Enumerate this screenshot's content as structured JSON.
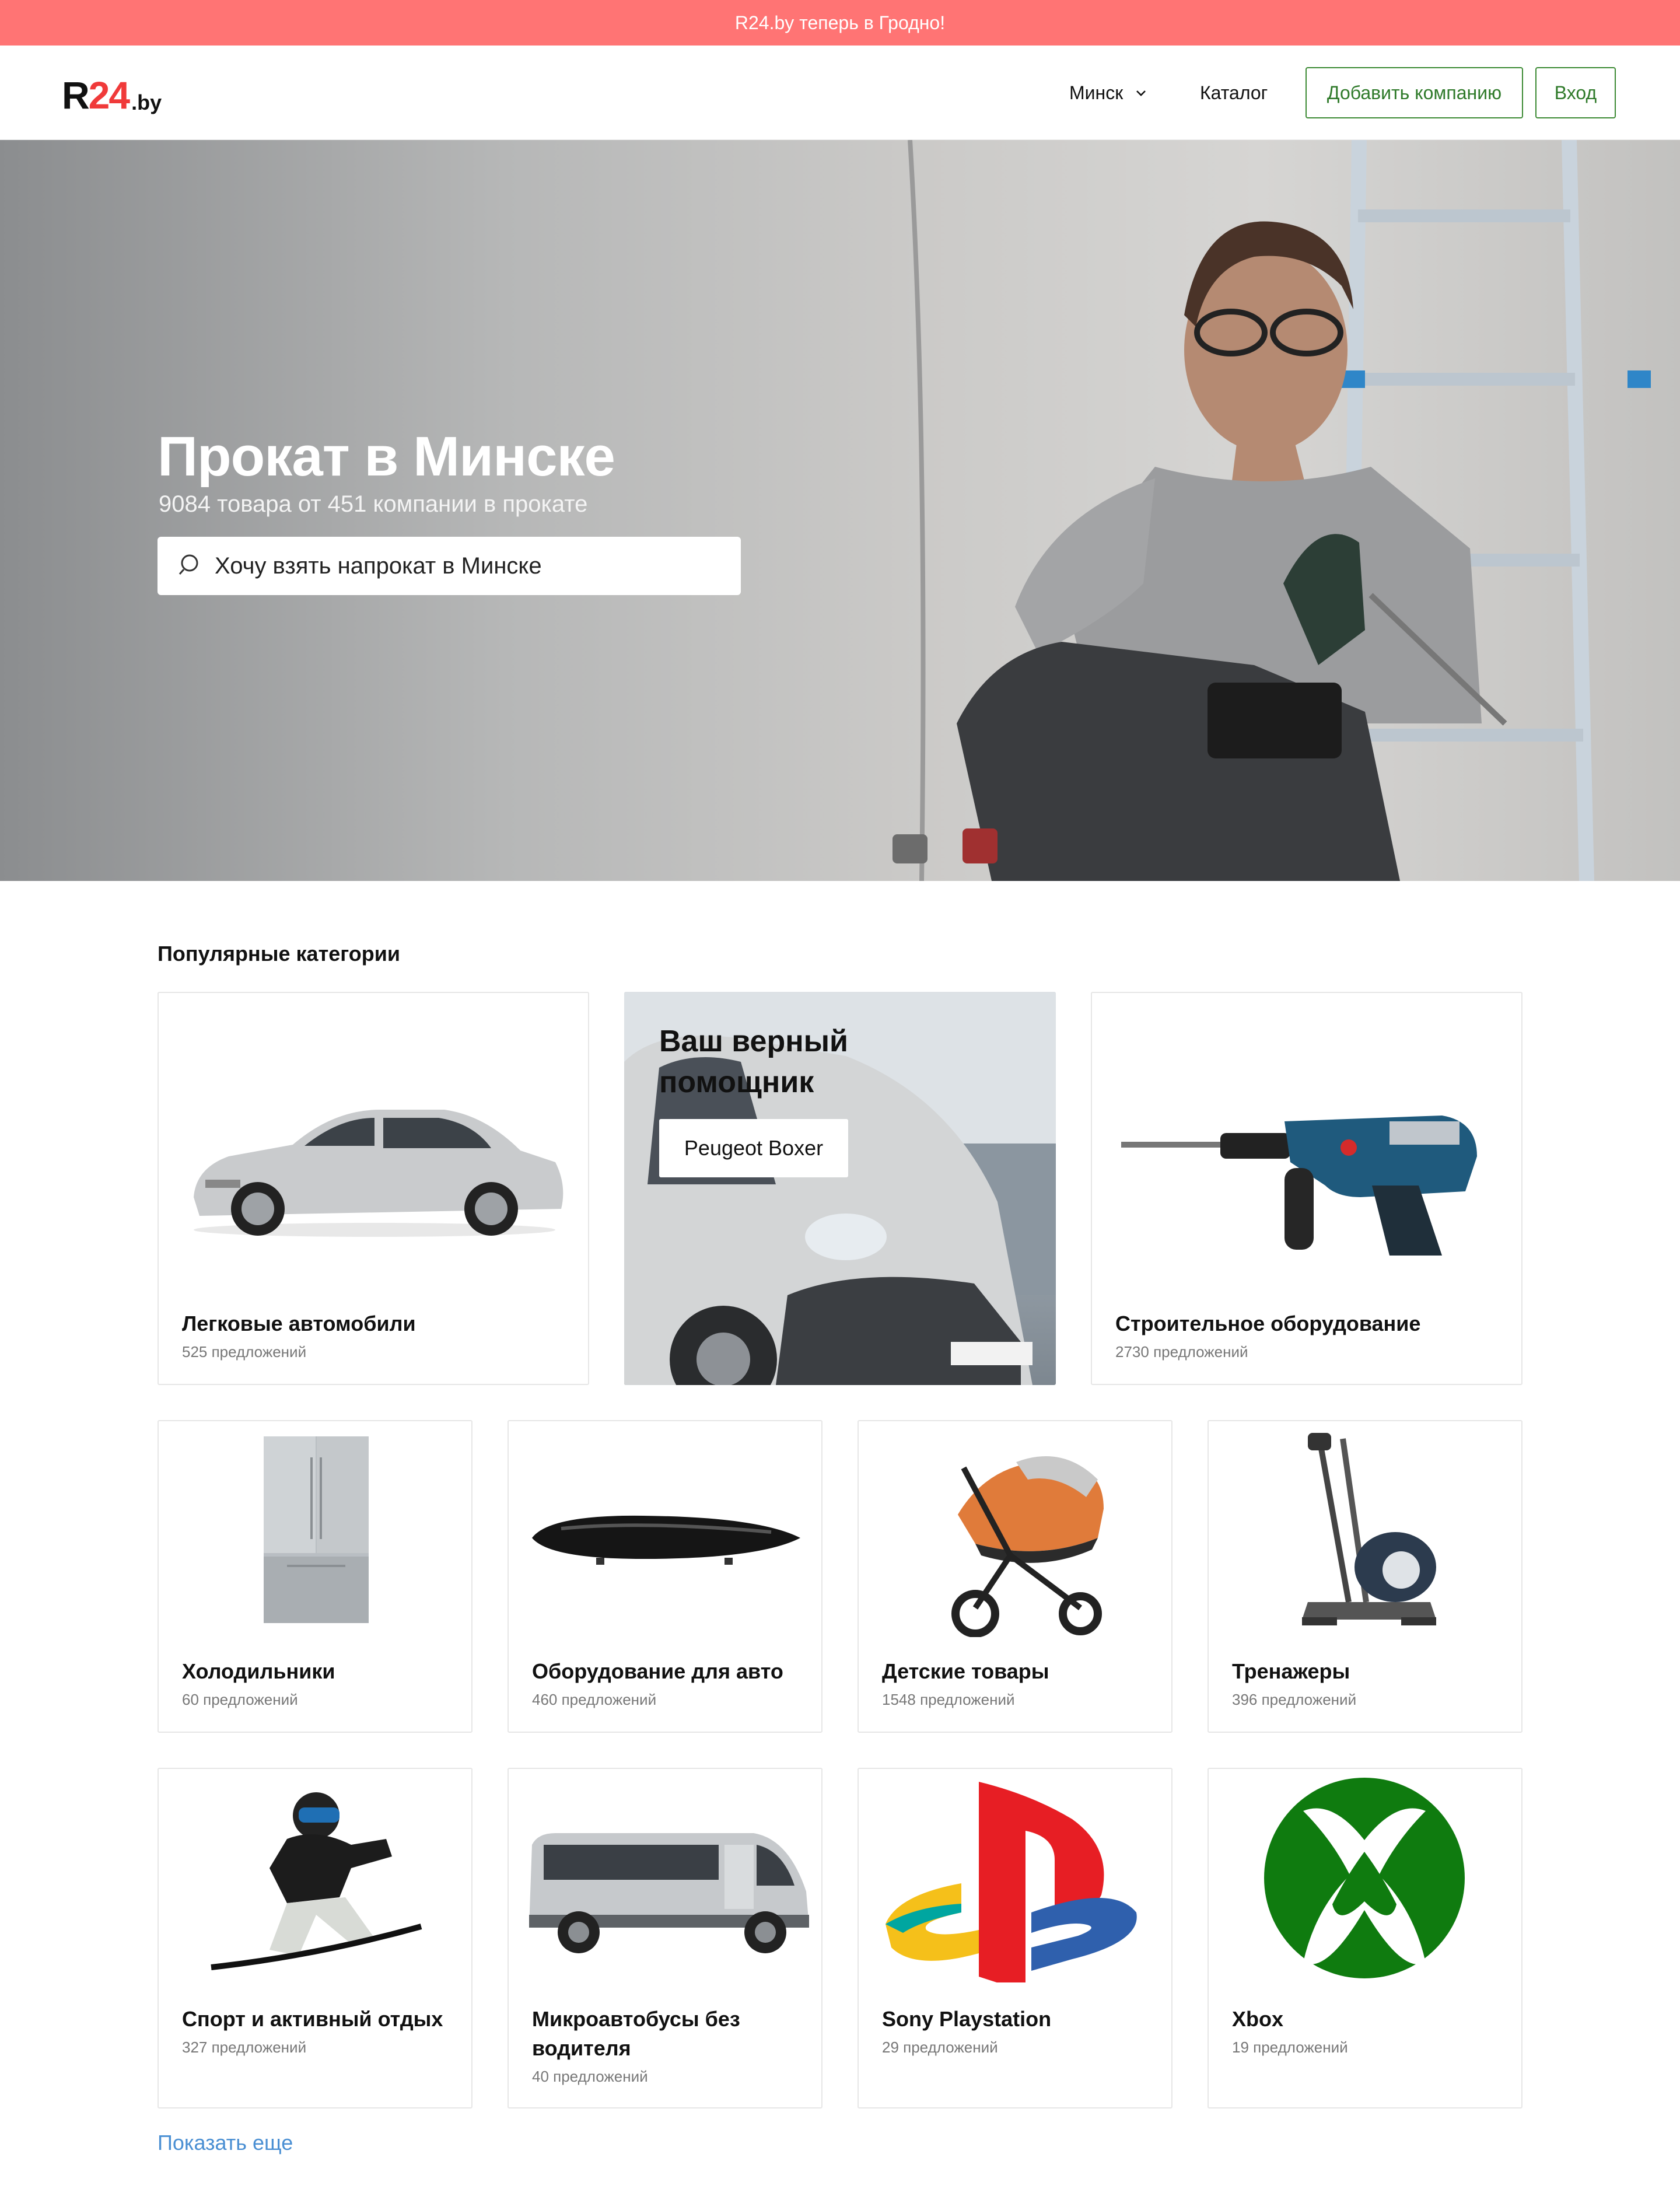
{
  "banner": {
    "text": "R24.by теперь в Гродно!"
  },
  "header": {
    "logo": {
      "r": "R",
      "num": "24",
      "domain": ".by"
    },
    "city": "Минск",
    "catalog": "Каталог",
    "add_company": "Добавить компанию",
    "login": "Вход"
  },
  "hero": {
    "title": "Прокат в Минске",
    "subtitle": "9084 товара от 451 компании в прокате",
    "search_placeholder": "Хочу взять напрокат в Минске"
  },
  "categories": {
    "title": "Популярные категории",
    "items": [
      {
        "name": "Легковые автомобили",
        "count": "525 предложений",
        "icon": "car-image"
      },
      {
        "name": "Строительное оборудование",
        "count": "2730 предложений",
        "icon": "drill-image"
      },
      {
        "name": "Холодильники",
        "count": "60 предложений",
        "icon": "fridge-image"
      },
      {
        "name": "Оборудование для авто",
        "count": "460 предложений",
        "icon": "roof-box-image"
      },
      {
        "name": "Детские товары",
        "count": "1548 предложений",
        "icon": "stroller-image"
      },
      {
        "name": "Тренажеры",
        "count": "396 предложений",
        "icon": "elliptical-trainer-image"
      },
      {
        "name": "Спорт и активный отдых",
        "count": "327 предложений",
        "icon": "snowboarder-image"
      },
      {
        "name": "Микроавтобусы без водителя",
        "count": "40 предложений",
        "icon": "minibus-image"
      },
      {
        "name": "Sony Playstation",
        "count": "29 предложений",
        "icon": "playstation-logo"
      },
      {
        "name": "Xbox",
        "count": "19 предложений",
        "icon": "xbox-logo"
      }
    ],
    "promo": {
      "title": "Ваш верный помощник",
      "button": "Peugeot Boxer"
    },
    "show_more": "Показать еще"
  },
  "colors": {
    "banner": "#ff7474",
    "accent_green": "#3c8a34",
    "logo_red": "#f03a3a",
    "link_blue": "#4a8fd3"
  }
}
